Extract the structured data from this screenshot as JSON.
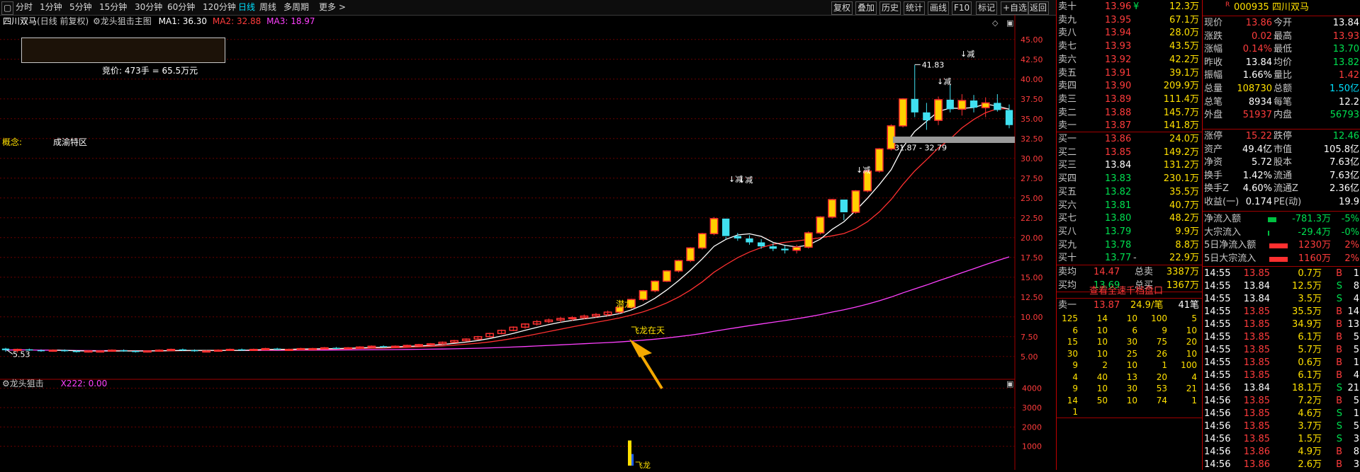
{
  "toolbar": {
    "left_items": [
      "分时",
      "1分钟",
      "5分钟",
      "15分钟",
      "30分钟",
      "60分钟",
      "120分钟",
      "日线",
      "周线",
      "多周期",
      "更多 >"
    ],
    "active": "日线",
    "right_items": [
      "复权",
      "叠加",
      "历史",
      "统计",
      "画线",
      "F10",
      "标记",
      "+自选",
      "返回"
    ]
  },
  "chart_header": {
    "stock": "四川双马",
    "period_info": "(日线 前复权)",
    "indicator_name": "龙头狙击主图",
    "ma1": "MA1: 36.30",
    "ma2": "MA2: 32.88",
    "ma3": "MA3: 18.97",
    "colors": {
      "ma1": "#ffffff",
      "ma2": "#ff3030",
      "ma3": "#ff40ff"
    }
  },
  "bid_box": {
    "text": "竞价: 473手 = 65.5万元"
  },
  "concept": {
    "label": "概念:",
    "value": "成渝特区"
  },
  "annotations": {
    "high": "41.83",
    "low": "5.53",
    "range": "31.87 - 32.79",
    "reduce": "↓减",
    "qianlong": "潜龙",
    "feilong": "飞龙在天"
  },
  "price_axis": [
    "45.00",
    "42.50",
    "40.00",
    "37.50",
    "35.00",
    "32.50",
    "30.00",
    "27.50",
    "25.00",
    "22.50",
    "20.00",
    "17.50",
    "15.00",
    "12.50",
    "10.00",
    "7.50",
    "5.00"
  ],
  "sub_indicator": {
    "name": "龙头狙击",
    "value": "X222: 0.00",
    "axis": [
      "4000",
      "3000",
      "2000",
      "1000"
    ],
    "flag": "飞龙"
  },
  "chart_data": {
    "type": "candlestick",
    "candles": [
      [
        6.0,
        6.1,
        5.6,
        5.8
      ],
      [
        5.8,
        6.0,
        5.5,
        5.9
      ],
      [
        5.9,
        6.0,
        5.7,
        5.8
      ],
      [
        5.8,
        5.9,
        5.6,
        5.7
      ],
      [
        5.7,
        5.9,
        5.6,
        5.8
      ],
      [
        5.8,
        5.9,
        5.6,
        5.7
      ],
      [
        5.7,
        5.8,
        5.5,
        5.6
      ],
      [
        5.6,
        5.8,
        5.5,
        5.7
      ],
      [
        5.7,
        5.8,
        5.6,
        5.7
      ],
      [
        5.7,
        5.9,
        5.6,
        5.8
      ],
      [
        5.8,
        5.9,
        5.6,
        5.7
      ],
      [
        5.7,
        5.8,
        5.5,
        5.6
      ],
      [
        5.6,
        5.8,
        5.5,
        5.7
      ],
      [
        5.7,
        5.9,
        5.6,
        5.8
      ],
      [
        5.8,
        6.0,
        5.7,
        5.9
      ],
      [
        5.9,
        6.0,
        5.7,
        5.8
      ],
      [
        5.8,
        5.9,
        5.6,
        5.7
      ],
      [
        5.7,
        5.8,
        5.6,
        5.7
      ],
      [
        5.7,
        5.9,
        5.6,
        5.8
      ],
      [
        5.8,
        6.0,
        5.7,
        5.9
      ],
      [
        5.9,
        6.0,
        5.7,
        5.8
      ],
      [
        5.8,
        6.0,
        5.7,
        5.9
      ],
      [
        5.9,
        6.1,
        5.8,
        6.0
      ],
      [
        6.0,
        6.1,
        5.8,
        5.9
      ],
      [
        5.9,
        6.0,
        5.8,
        5.9
      ],
      [
        5.9,
        6.1,
        5.8,
        6.0
      ],
      [
        6.0,
        6.1,
        5.9,
        6.0
      ],
      [
        6.0,
        6.2,
        5.9,
        6.1
      ],
      [
        6.1,
        6.2,
        5.9,
        6.0
      ],
      [
        6.0,
        6.2,
        5.9,
        6.1
      ],
      [
        6.1,
        6.3,
        6.0,
        6.2
      ],
      [
        6.2,
        6.4,
        6.1,
        6.3
      ],
      [
        6.3,
        6.4,
        6.1,
        6.2
      ],
      [
        6.2,
        6.4,
        6.1,
        6.3
      ],
      [
        6.3,
        6.5,
        6.2,
        6.4
      ],
      [
        6.4,
        6.6,
        6.3,
        6.5
      ],
      [
        6.5,
        6.7,
        6.4,
        6.6
      ],
      [
        6.6,
        6.9,
        6.5,
        6.8
      ],
      [
        6.8,
        7.1,
        6.7,
        7.0
      ],
      [
        7.0,
        7.3,
        6.9,
        7.2
      ],
      [
        7.2,
        7.6,
        7.1,
        7.5
      ],
      [
        7.5,
        8.0,
        7.4,
        7.9
      ],
      [
        7.9,
        8.4,
        7.8,
        8.3
      ],
      [
        8.3,
        8.8,
        8.2,
        8.7
      ],
      [
        8.7,
        9.2,
        8.5,
        9.1
      ],
      [
        9.1,
        9.6,
        8.9,
        9.4
      ],
      [
        9.4,
        9.8,
        9.2,
        9.6
      ],
      [
        9.6,
        10.0,
        9.3,
        9.8
      ],
      [
        9.8,
        10.1,
        9.5,
        9.9
      ],
      [
        9.9,
        10.3,
        9.7,
        10.1
      ],
      [
        10.1,
        10.5,
        9.9,
        10.3
      ],
      [
        10.3,
        10.8,
        10.1,
        10.6
      ],
      [
        10.6,
        11.3,
        10.4,
        11.2
      ],
      [
        11.2,
        12.3,
        11.0,
        12.2
      ],
      [
        12.2,
        13.4,
        12.0,
        13.3
      ],
      [
        13.3,
        14.6,
        13.1,
        14.5
      ],
      [
        14.5,
        15.9,
        14.4,
        15.8
      ],
      [
        15.8,
        17.2,
        15.6,
        17.1
      ],
      [
        17.1,
        18.8,
        16.9,
        18.7
      ],
      [
        18.7,
        20.6,
        18.5,
        20.5
      ],
      [
        20.5,
        22.6,
        20.3,
        22.4
      ],
      [
        22.4,
        20.1,
        19.8,
        20.2
      ],
      [
        20.2,
        20.6,
        19.6,
        19.9
      ],
      [
        19.9,
        20.3,
        19.1,
        19.4
      ],
      [
        19.4,
        19.8,
        18.6,
        18.9
      ],
      [
        18.9,
        19.3,
        18.3,
        18.6
      ],
      [
        18.6,
        19.0,
        18.0,
        18.4
      ],
      [
        18.4,
        19.1,
        18.0,
        18.8
      ],
      [
        18.8,
        20.8,
        18.6,
        20.6
      ],
      [
        20.6,
        22.7,
        20.4,
        22.6
      ],
      [
        22.6,
        24.9,
        22.4,
        24.8
      ],
      [
        24.8,
        23.0,
        22.2,
        23.2
      ],
      [
        23.2,
        26.0,
        23.0,
        25.9
      ],
      [
        25.9,
        28.6,
        25.7,
        28.4
      ],
      [
        28.4,
        31.3,
        28.2,
        31.2
      ],
      [
        31.2,
        34.3,
        31.0,
        34.1
      ],
      [
        34.1,
        37.6,
        33.9,
        37.5
      ],
      [
        37.5,
        41.8,
        35.2,
        35.8
      ],
      [
        35.8,
        37.0,
        33.6,
        34.8
      ],
      [
        34.8,
        37.8,
        34.2,
        37.4
      ],
      [
        37.4,
        39.3,
        35.8,
        36.2
      ],
      [
        36.2,
        38.1,
        35.4,
        37.3
      ],
      [
        37.3,
        38.0,
        35.8,
        36.4
      ],
      [
        36.4,
        37.7,
        35.2,
        37.0
      ],
      [
        37.0,
        38.1,
        35.9,
        36.1
      ],
      [
        36.1,
        36.8,
        33.8,
        34.2
      ]
    ]
  },
  "orderbook": {
    "asks": [
      {
        "label": "卖十",
        "price": "13.96",
        "vol": "12.3万",
        "mark": "¥"
      },
      {
        "label": "卖九",
        "price": "13.95",
        "vol": "67.1万"
      },
      {
        "label": "卖八",
        "price": "13.94",
        "vol": "28.0万"
      },
      {
        "label": "卖七",
        "price": "13.93",
        "vol": "43.5万"
      },
      {
        "label": "卖六",
        "price": "13.92",
        "vol": "42.2万"
      },
      {
        "label": "卖五",
        "price": "13.91",
        "vol": "39.1万"
      },
      {
        "label": "卖四",
        "price": "13.90",
        "vol": "209.9万"
      },
      {
        "label": "卖三",
        "price": "13.89",
        "vol": "111.4万"
      },
      {
        "label": "卖二",
        "price": "13.88",
        "vol": "145.7万"
      },
      {
        "label": "卖一",
        "price": "13.87",
        "vol": "141.8万"
      }
    ],
    "bids": [
      {
        "label": "买一",
        "price": "13.86",
        "vol": "24.0万"
      },
      {
        "label": "买二",
        "price": "13.85",
        "vol": "149.2万"
      },
      {
        "label": "买三",
        "price": "13.84",
        "vol": "131.2万"
      },
      {
        "label": "买四",
        "price": "13.83",
        "vol": "230.1万"
      },
      {
        "label": "买五",
        "price": "13.82",
        "vol": "35.5万"
      },
      {
        "label": "买六",
        "price": "13.81",
        "vol": "40.7万"
      },
      {
        "label": "买七",
        "price": "13.80",
        "vol": "48.2万"
      },
      {
        "label": "买八",
        "price": "13.79",
        "vol": "9.9万"
      },
      {
        "label": "买九",
        "price": "13.78",
        "vol": "8.8万"
      },
      {
        "label": "买十",
        "price": "13.77",
        "vol": "22.9万",
        "mark": "-"
      }
    ],
    "avg": [
      {
        "label": "卖均",
        "price": "14.47",
        "tlabel": "总卖",
        "tvol": "3387万"
      },
      {
        "label": "买均",
        "price": "13.69",
        "tlabel": "总买",
        "tvol": "1367万"
      }
    ],
    "view_full": "查看全速千档盘口",
    "queue_head": {
      "label": "卖一",
      "price": "13.87",
      "avg": "24.9/笔",
      "count": "41笔"
    },
    "queue": [
      [
        "125",
        "14",
        "10",
        "100",
        "5"
      ],
      [
        "6",
        "10",
        "6",
        "9",
        "10"
      ],
      [
        "15",
        "10",
        "30",
        "75",
        "20"
      ],
      [
        "30",
        "10",
        "25",
        "26",
        "10"
      ],
      [
        "9",
        "2",
        "10",
        "1",
        "100"
      ],
      [
        "4",
        "40",
        "13",
        "20",
        "4"
      ],
      [
        "9",
        "10",
        "30",
        "53",
        "21"
      ],
      [
        "14",
        "50",
        "10",
        "74",
        "1"
      ],
      [
        "1",
        "",
        "",
        "",
        ""
      ]
    ]
  },
  "stats": {
    "badge": "R",
    "code": "000935",
    "name": "四川双马",
    "grid": [
      {
        "l1": "现价",
        "v1": "13.86",
        "c1": "red",
        "l2": "今开",
        "v2": "13.84",
        "c2": "white"
      },
      {
        "l1": "涨跌",
        "v1": "0.02",
        "c1": "red",
        "l2": "最高",
        "v2": "13.93",
        "c2": "red"
      },
      {
        "l1": "涨幅",
        "v1": "0.14%",
        "c1": "red",
        "l2": "最低",
        "v2": "13.70",
        "c2": "green"
      },
      {
        "l1": "昨收",
        "v1": "13.84",
        "c1": "white",
        "l2": "均价",
        "v2": "13.82",
        "c2": "green"
      },
      {
        "l1": "振幅",
        "v1": "1.66%",
        "c1": "white",
        "l2": "量比",
        "v2": "1.42",
        "c2": "red"
      },
      {
        "l1": "总量",
        "v1": "108730",
        "c1": "yellow",
        "l2": "总额",
        "v2": "1.50亿",
        "c2": "cyan"
      },
      {
        "l1": "总笔",
        "v1": "8934",
        "c1": "white",
        "l2": "每笔",
        "v2": "12.2",
        "c2": "white"
      },
      {
        "l1": "外盘",
        "v1": "51937",
        "c1": "red",
        "l2": "内盘",
        "v2": "56793",
        "c2": "green"
      }
    ],
    "grid2": [
      {
        "l1": "涨停",
        "v1": "15.22",
        "c1": "red",
        "l2": "跌停",
        "v2": "12.46",
        "c2": "green"
      },
      {
        "l1": "资产",
        "v1": "49.4亿",
        "c1": "white",
        "l2": "市值",
        "v2": "105.8亿",
        "c2": "white"
      },
      {
        "l1": "净资",
        "v1": "5.72",
        "c1": "white",
        "l2": "股本",
        "v2": "7.63亿",
        "c2": "white"
      },
      {
        "l1": "换手",
        "v1": "1.42%",
        "c1": "white",
        "l2": "流通",
        "v2": "7.63亿",
        "c2": "white"
      },
      {
        "l1": "换手Z",
        "v1": "4.60%",
        "c1": "white",
        "l2": "流通Z",
        "v2": "2.36亿",
        "c2": "white"
      },
      {
        "l1": "收益(一)",
        "v1": "0.174",
        "c1": "white",
        "l2": "PE(动)",
        "v2": "19.9",
        "c2": "white"
      }
    ],
    "flows": [
      {
        "label": "净流入额",
        "value": "-781.3万",
        "pct": "-5%",
        "color": "green",
        "bar": "green"
      },
      {
        "label": "大宗流入",
        "value": "-29.4万",
        "pct": "-0%",
        "color": "green",
        "bar": "green"
      },
      {
        "label": "5日净流入额",
        "value": "1230万",
        "pct": "2%",
        "color": "red",
        "bar": "red"
      },
      {
        "label": "5日大宗流入",
        "value": "1160万",
        "pct": "2%",
        "color": "red",
        "bar": "red"
      }
    ],
    "ticks": [
      {
        "t": "14:55",
        "p": "13.85",
        "c": "red",
        "v": "0.7万",
        "s": "B",
        "n": "1"
      },
      {
        "t": "14:55",
        "p": "13.84",
        "c": "white",
        "v": "12.5万",
        "s": "S",
        "n": "8"
      },
      {
        "t": "14:55",
        "p": "13.84",
        "c": "white",
        "v": "3.5万",
        "s": "S",
        "n": "4"
      },
      {
        "t": "14:55",
        "p": "13.85",
        "c": "red",
        "v": "35.5万",
        "s": "B",
        "n": "14"
      },
      {
        "t": "14:55",
        "p": "13.85",
        "c": "red",
        "v": "34.9万",
        "s": "B",
        "n": "13"
      },
      {
        "t": "14:55",
        "p": "13.85",
        "c": "red",
        "v": "6.1万",
        "s": "B",
        "n": "5"
      },
      {
        "t": "14:55",
        "p": "13.85",
        "c": "red",
        "v": "5.7万",
        "s": "B",
        "n": "5"
      },
      {
        "t": "14:55",
        "p": "13.85",
        "c": "red",
        "v": "0.6万",
        "s": "B",
        "n": "1"
      },
      {
        "t": "14:55",
        "p": "13.85",
        "c": "red",
        "v": "6.1万",
        "s": "B",
        "n": "4"
      },
      {
        "t": "14:56",
        "p": "13.84",
        "c": "white",
        "v": "18.1万",
        "s": "S",
        "n": "21"
      },
      {
        "t": "14:56",
        "p": "13.85",
        "c": "red",
        "v": "7.2万",
        "s": "B",
        "n": "5"
      },
      {
        "t": "14:56",
        "p": "13.85",
        "c": "red",
        "v": "4.6万",
        "s": "S",
        "n": "1"
      },
      {
        "t": "14:56",
        "p": "13.85",
        "c": "red",
        "v": "3.7万",
        "s": "S",
        "n": "5"
      },
      {
        "t": "14:56",
        "p": "13.85",
        "c": "red",
        "v": "1.5万",
        "s": "S",
        "n": "3"
      },
      {
        "t": "14:56",
        "p": "13.86",
        "c": "red",
        "v": "4.9万",
        "s": "B",
        "n": "8"
      },
      {
        "t": "14:56",
        "p": "13.86",
        "c": "red",
        "v": "2.6万",
        "s": "B",
        "n": "3"
      }
    ]
  }
}
